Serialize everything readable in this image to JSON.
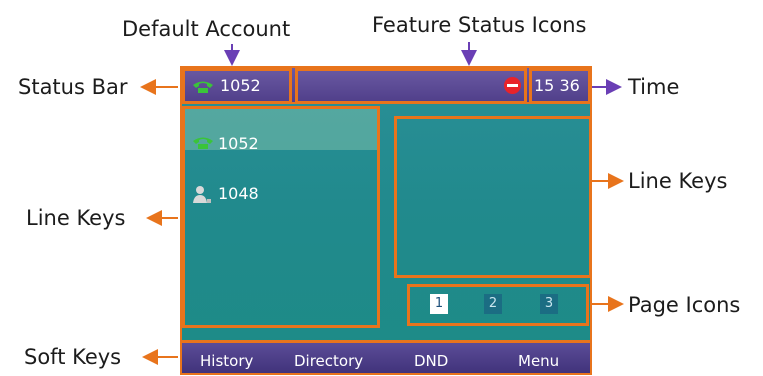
{
  "callouts": {
    "default_account": "Default Account",
    "feature_status_icons": "Feature Status Icons",
    "status_bar": "Status Bar",
    "time": "Time",
    "line_keys_right": "Line Keys",
    "line_keys_left": "Line Keys",
    "page_icons": "Page Icons",
    "soft_keys": "Soft Keys"
  },
  "status_bar": {
    "account": "1052",
    "time": "15 36",
    "account_icon": "phone-handset-icon",
    "feature_icon": "dnd-icon"
  },
  "line_keys": [
    {
      "label": "1052",
      "icon": "phone-handset-icon"
    },
    {
      "label": "1048",
      "icon": "user-icon"
    }
  ],
  "page_icons": [
    "1",
    "2",
    "3"
  ],
  "soft_keys": [
    "History",
    "Directory",
    "DND",
    "Menu"
  ],
  "colors": {
    "accent": "#e8741c",
    "arrow": "#6a3fb5",
    "screen_teal": "#218a8d",
    "bar_purple": "#503f8a"
  }
}
